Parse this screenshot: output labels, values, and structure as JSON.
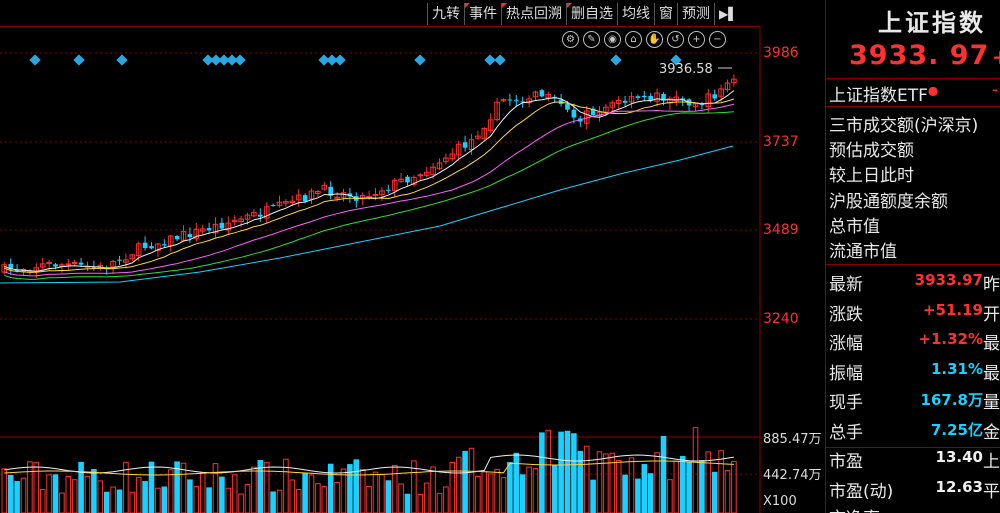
{
  "toolbar": {
    "items": [
      {
        "label": "九转",
        "flag": false
      },
      {
        "label": "事件",
        "flag": true
      },
      {
        "label": "热点回溯",
        "flag": true
      },
      {
        "label": "删自选",
        "flag": true
      },
      {
        "label": "均线",
        "flag": false
      },
      {
        "label": "窗",
        "flag": false
      },
      {
        "label": "预测",
        "flag": false
      }
    ],
    "play_glyph": "▶▌",
    "tool_icons": [
      "settings-icon",
      "pen-icon",
      "eye-icon",
      "lock-icon",
      "hand-icon",
      "reset-icon",
      "zoom-in-icon",
      "zoom-out-icon"
    ],
    "tool_glyphs": [
      "⚙",
      "✎",
      "◉",
      "⌂",
      "✋",
      "↺",
      "+",
      "−"
    ]
  },
  "price_axis": {
    "labels": [
      "3986",
      "3737",
      "3489",
      "3240"
    ]
  },
  "volume_axis": {
    "labels": [
      "885.47万",
      "442.74万"
    ],
    "multiplier": "X100"
  },
  "last_price_label": "3936.58",
  "colors": {
    "up": "#ff3030",
    "down": "#19d0ff",
    "ma5": "#f0f0f0",
    "ma10": "#ffd83a",
    "ma20": "#ff60ff",
    "ma30": "#30dd30",
    "ma60": "#19d0ff",
    "marker": "#2aa6e0"
  },
  "side": {
    "title": "上证指数",
    "price": "3933. 97",
    "price_tail": "+",
    "etf_label": "上证指数ETF",
    "etf_dot": "●",
    "etf_tail": "-",
    "info_lines": [
      "三市成交额(沪深京)",
      "预估成交额",
      "较上日此时",
      "沪股通额度余额",
      "总市值",
      "流通市值"
    ],
    "rows": [
      {
        "label": "最新",
        "value": "3933.97",
        "color": "red",
        "tail": "昨"
      },
      {
        "label": "涨跌",
        "value": "+51.19",
        "color": "red",
        "tail": "开"
      },
      {
        "label": "涨幅",
        "value": "+1.32%",
        "color": "red",
        "tail": "最"
      },
      {
        "label": "振幅",
        "value": "1.31%",
        "color": "cyan",
        "tail": "最"
      },
      {
        "label": "现手",
        "value": "167.8万",
        "color": "cyan",
        "tail": "量"
      },
      {
        "label": "总手",
        "value": "7.25亿",
        "color": "cyan",
        "tail": "金"
      },
      {
        "label": "市盈",
        "value": "13.40",
        "color": "white",
        "tail": "上"
      },
      {
        "label": "市盈(动)",
        "value": "12.63",
        "color": "white",
        "tail": "平"
      }
    ],
    "bottom_partial": "市净率"
  }
}
